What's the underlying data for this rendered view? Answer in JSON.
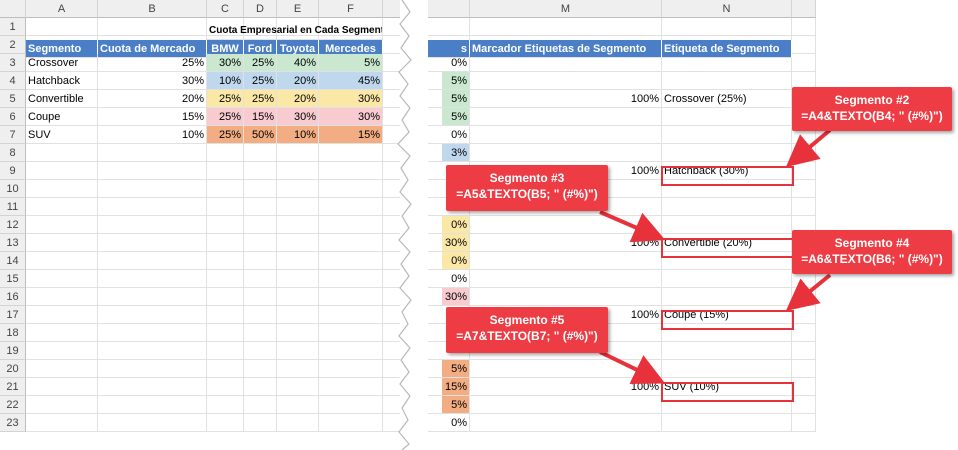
{
  "left": {
    "columns": [
      "A",
      "B",
      "C",
      "D",
      "E",
      "F"
    ],
    "rows": [
      "1",
      "2",
      "3",
      "4",
      "5",
      "6",
      "7",
      "8",
      "9",
      "10",
      "11",
      "12",
      "13",
      "14",
      "15",
      "16",
      "17",
      "18",
      "19",
      "20",
      "21",
      "22",
      "23"
    ],
    "title": "Cuota Empresarial en Cada Segmento",
    "headers": [
      "Segmento",
      "Cuota de Mercado",
      "BMW",
      "Ford",
      "Toyota",
      "Mercedes"
    ],
    "data": [
      [
        "Crossover",
        "25%",
        "30%",
        "25%",
        "40%",
        "5%"
      ],
      [
        "Hatchback",
        "30%",
        "10%",
        "25%",
        "20%",
        "45%"
      ],
      [
        "Convertible",
        "20%",
        "25%",
        "25%",
        "20%",
        "30%"
      ],
      [
        "Coupe",
        "15%",
        "25%",
        "15%",
        "30%",
        "30%"
      ],
      [
        "SUV",
        "10%",
        "25%",
        "50%",
        "10%",
        "15%"
      ]
    ]
  },
  "right": {
    "columns": [
      "M",
      "N"
    ],
    "headers": [
      "Marcador Etiquetas de Segmento",
      "Etiqueta de Segmento"
    ],
    "partial_header": "s",
    "partial_col": [
      "0%",
      "5%",
      "5%",
      "5%",
      "0%",
      "3%",
      "",
      "",
      "",
      "0%",
      "30%",
      "0%",
      "0%",
      "30%",
      "",
      "",
      "",
      "5%",
      "15%",
      "5%",
      "0%"
    ],
    "markers": [
      {
        "row": 5,
        "value": "100%",
        "label": "Crossover (25%)"
      },
      {
        "row": 9,
        "value": "100%",
        "label": "Hatchback (30%)"
      },
      {
        "row": 13,
        "value": "100%",
        "label": "Convertible (20%)"
      },
      {
        "row": 17,
        "value": "100%",
        "label": "Coupe (15%)"
      },
      {
        "row": 21,
        "value": "100%",
        "label": "SUV (10%)"
      }
    ]
  },
  "callouts": [
    {
      "title": "Segmento #2",
      "formula": "=A4&TEXTO(B4; \" (#%)\")"
    },
    {
      "title": "Segmento #3",
      "formula": "=A5&TEXTO(B5; \" (#%)\")"
    },
    {
      "title": "Segmento #4",
      "formula": "=A6&TEXTO(B6; \" (#%)\")"
    },
    {
      "title": "Segmento #5",
      "formula": "=A7&TEXTO(B7; \" (#%)\")"
    }
  ],
  "colors": {
    "header": "#4a7ec7",
    "callout": "#ee3c45",
    "highlight": "#e8323b"
  }
}
